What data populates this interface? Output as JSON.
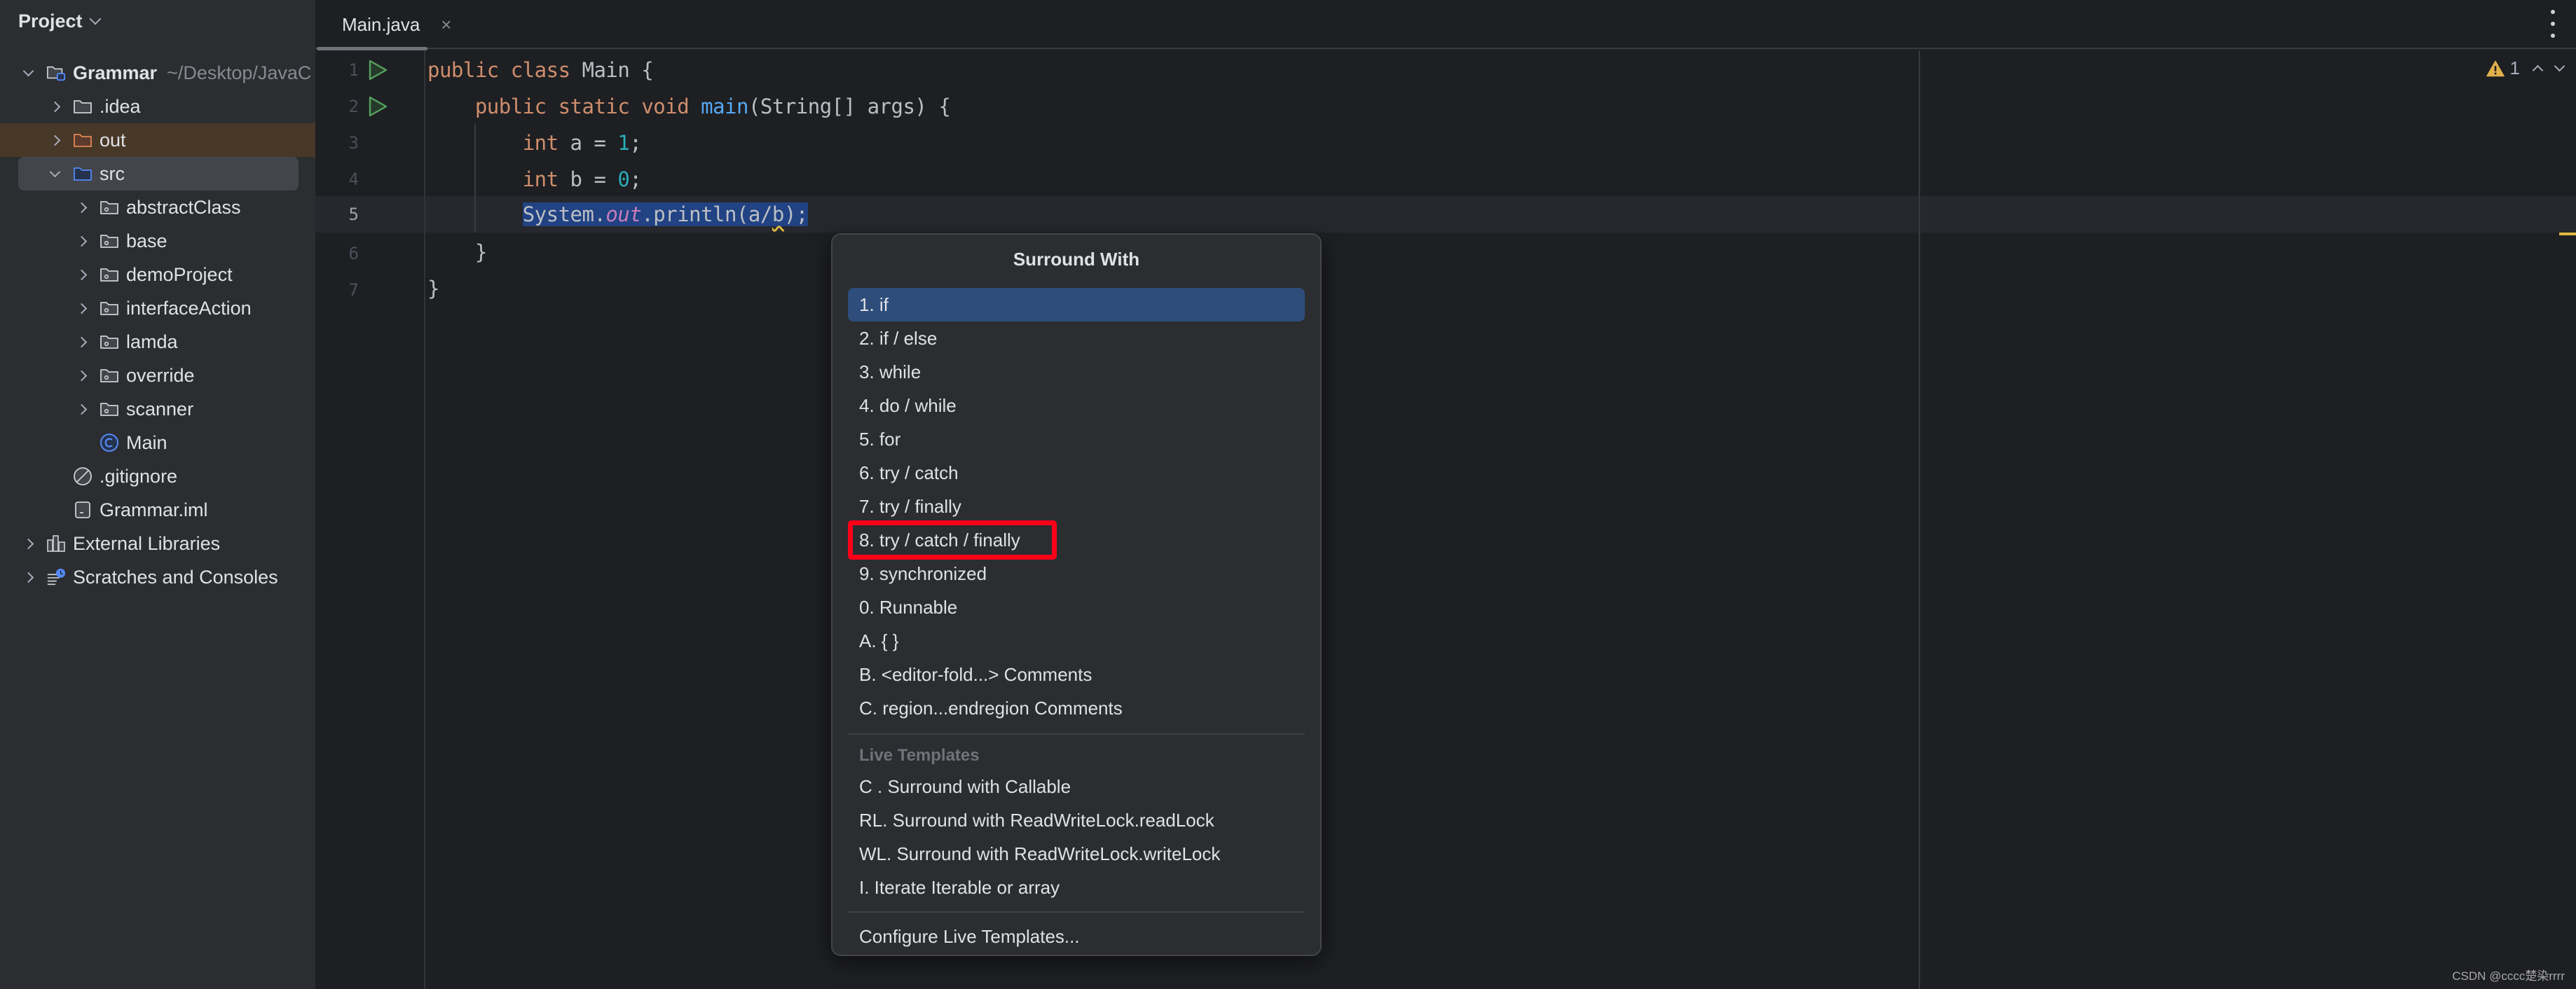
{
  "sidebar": {
    "title": "Project",
    "tree": [
      {
        "level": 0,
        "expanded": true,
        "icon": "module-folder-icon",
        "label": "Grammar",
        "path": "~/Desktop/JavaC",
        "bold": true
      },
      {
        "level": 1,
        "expanded": false,
        "icon": "folder-icon",
        "label": ".idea"
      },
      {
        "level": 1,
        "expanded": false,
        "icon": "excluded-folder-icon",
        "label": "out",
        "state": "excluded"
      },
      {
        "level": 1,
        "expanded": true,
        "icon": "source-folder-icon",
        "label": "src",
        "state": "selected"
      },
      {
        "level": 2,
        "expanded": false,
        "icon": "package-icon",
        "label": "abstractClass"
      },
      {
        "level": 2,
        "expanded": false,
        "icon": "package-icon",
        "label": "base"
      },
      {
        "level": 2,
        "expanded": false,
        "icon": "package-icon",
        "label": "demoProject"
      },
      {
        "level": 2,
        "expanded": false,
        "icon": "package-icon",
        "label": "interfaceAction"
      },
      {
        "level": 2,
        "expanded": false,
        "icon": "package-icon",
        "label": "lamda"
      },
      {
        "level": 2,
        "expanded": false,
        "icon": "package-icon",
        "label": "override"
      },
      {
        "level": 2,
        "expanded": false,
        "icon": "package-icon",
        "label": "scanner"
      },
      {
        "level": 2,
        "expanded": null,
        "icon": "java-class-icon",
        "label": "Main"
      },
      {
        "level": 1,
        "expanded": null,
        "icon": "ignore-file-icon",
        "label": ".gitignore"
      },
      {
        "level": 1,
        "expanded": null,
        "icon": "iml-file-icon",
        "label": "Grammar.iml"
      },
      {
        "level": 0,
        "expanded": false,
        "icon": "library-icon",
        "label": "External Libraries"
      },
      {
        "level": 0,
        "expanded": false,
        "icon": "scratches-icon",
        "label": "Scratches and Consoles"
      }
    ]
  },
  "editor": {
    "tab": {
      "label": "Main.java",
      "icon": "java-class-icon",
      "close": "×"
    },
    "inspection": {
      "icon": "warning-icon",
      "count": "1"
    },
    "current_line": 5,
    "lines": [
      {
        "n": "1",
        "run": true
      },
      {
        "n": "2",
        "run": true
      },
      {
        "n": "3",
        "run": false
      },
      {
        "n": "4",
        "run": false
      },
      {
        "n": "5",
        "run": false
      },
      {
        "n": "6",
        "run": false
      },
      {
        "n": "7",
        "run": false
      }
    ],
    "code": {
      "l1": {
        "kw1": "public",
        "kw2": "class",
        "rest": " Main {"
      },
      "l2": {
        "indent": "    ",
        "kw1": "public",
        "kw2": "static",
        "kw3": "void",
        "fn": "main",
        "rest": "(String[] args) {"
      },
      "l3": {
        "indent": "        ",
        "kw": "int",
        "mid": " a = ",
        "num": "1",
        "end": ";"
      },
      "l4": {
        "indent": "        ",
        "kw": "int",
        "mid": " b = ",
        "num": "0",
        "end": ";"
      },
      "l5": {
        "indent": "        ",
        "a": "System.",
        "field": "out",
        "b": ".println(a/",
        "warn": "b",
        "c": ");"
      },
      "l6": {
        "text": "    }"
      },
      "l7": {
        "text": "}"
      }
    }
  },
  "popup": {
    "title": "Surround With",
    "items": [
      {
        "label": "1. if",
        "active": true
      },
      {
        "label": "2. if / else"
      },
      {
        "label": "3. while"
      },
      {
        "label": "4. do / while"
      },
      {
        "label": "5. for"
      },
      {
        "label": "6. try / catch"
      },
      {
        "label": "7. try / finally"
      },
      {
        "label": "8. try / catch / finally",
        "highlighted": true
      },
      {
        "label": "9. synchronized"
      },
      {
        "label": "0. Runnable"
      },
      {
        "label": "A. { }"
      },
      {
        "label": "B. <editor-fold...> Comments"
      },
      {
        "label": "C. region...endregion Comments"
      }
    ],
    "live_templates_header": "Live Templates",
    "live_templates": [
      {
        "label": "C . Surround with Callable"
      },
      {
        "label": "RL. Surround with ReadWriteLock.readLock"
      },
      {
        "label": "WL. Surround with ReadWriteLock.writeLock"
      },
      {
        "label": "I. Iterate Iterable or array"
      }
    ],
    "configure": "Configure Live Templates...",
    "highlight_color": "#ff0019",
    "active_color": "#2e4d7b"
  },
  "watermark": "CSDN @cccc楚染rrrr"
}
